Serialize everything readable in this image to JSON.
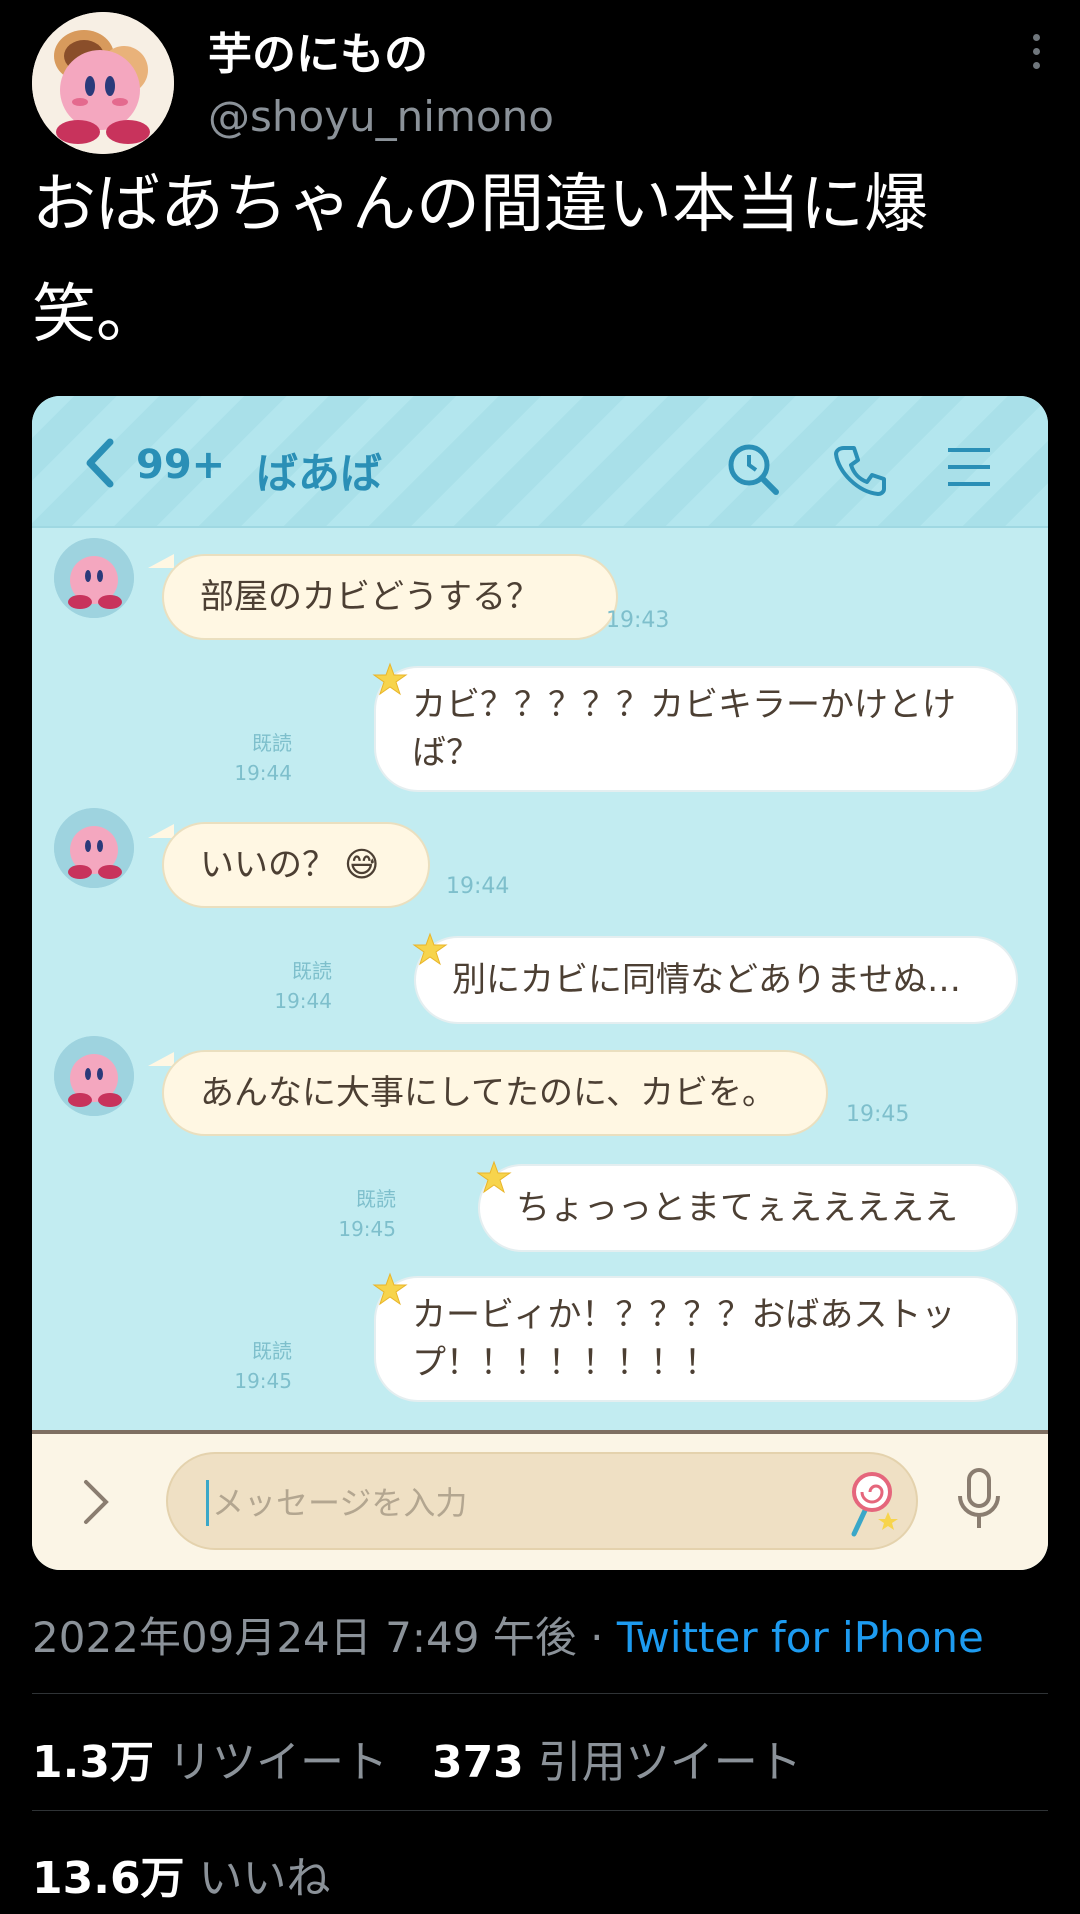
{
  "user": {
    "display_name": "芋のにもの",
    "handle": "@shoyu_nimono"
  },
  "tweet": {
    "text_line1": "おばあちゃんの間違い本当に爆",
    "text_line2": "笑。"
  },
  "chat": {
    "unread": "99+",
    "name": "ばあば",
    "messages": [
      {
        "text": "部屋のカビどうする？",
        "time": "19:43"
      },
      {
        "line1": "カビ？？？？？カビキラーかけとけ",
        "line2": "ば？",
        "read": "既読",
        "time": "19:44"
      },
      {
        "text": "いいの？",
        "emoji": "😅",
        "time": "19:44"
      },
      {
        "text": "別にカビに同情などありませぬ…",
        "read": "既読",
        "time": "19:44"
      },
      {
        "text": "あんなに大事にしてたのに、カビを。",
        "time": "19:45"
      },
      {
        "text": "ちょっっとまてぇえええええ",
        "read": "既読",
        "time": "19:45"
      },
      {
        "line1": "カービィか！？？？？おばあストッ",
        "line2": "プ！！！！！！！！",
        "read": "既読",
        "time": "19:45"
      }
    ],
    "input_placeholder": "メッセージを入力"
  },
  "meta": {
    "datetime": "2022年09月24日 7:49 午後 · ",
    "source": "Twitter for iPhone"
  },
  "stats": {
    "retweets": "1.3万",
    "retweets_label": " リツイート",
    "quotes": "373",
    "quotes_label": " 引用ツイート",
    "likes": "13.6万",
    "likes_label": " いいね"
  },
  "colors": {
    "chat_bg": "#c2ecf1",
    "header_accent": "#2a8fb6",
    "link": "#1d9bf0"
  }
}
